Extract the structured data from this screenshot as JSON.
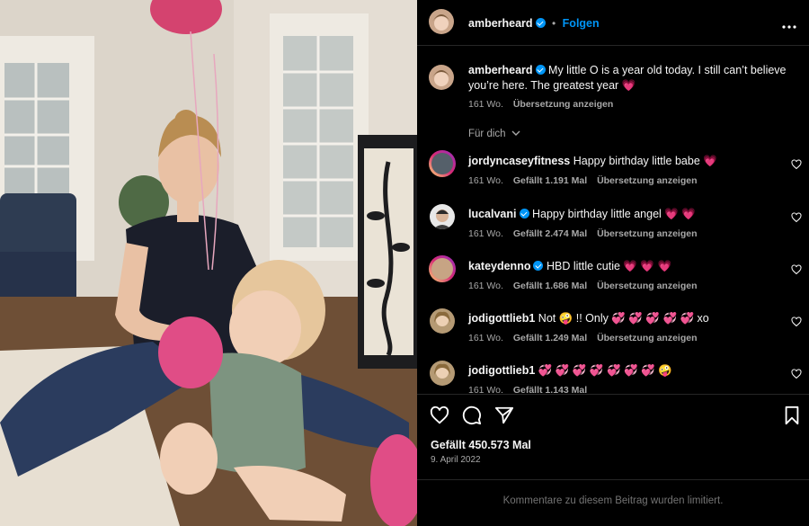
{
  "post": {
    "username": "amberheard",
    "follow_label": "Folgen",
    "caption": "My little O is a year old today. I still can’t believe you’re here. The greatest year",
    "caption_emoji": "💗",
    "caption_age": "161 Wo.",
    "caption_translate": "Übersetzung anzeigen",
    "filter_label": "Für dich",
    "likes": "Gefällt 450.573 Mal",
    "date": "9. April 2022",
    "comments_limited": "Kommentare zu diesem Beitrag wurden limitiert."
  },
  "comments": [
    {
      "username": "jordyncaseyfitness",
      "verified": false,
      "text": "Happy birthday little babe 💗",
      "age": "161 Wo.",
      "likes": "Gefällt 1.191 Mal",
      "translate": "Übersetzung anzeigen"
    },
    {
      "username": "lucalvani",
      "verified": true,
      "text": "Happy birthday little angel 💗 💗",
      "age": "161 Wo.",
      "likes": "Gefällt 2.474 Mal",
      "translate": "Übersetzung anzeigen"
    },
    {
      "username": "kateydenno",
      "verified": true,
      "text": "HBD little cutie 💗 💗 💗",
      "age": "161 Wo.",
      "likes": "Gefällt 1.686 Mal",
      "translate": "Übersetzung anzeigen"
    },
    {
      "username": "jodigottlieb1",
      "verified": false,
      "text": "Not 🤪 !! Only 💞 💞 💞 💞 💞 xo",
      "age": "161 Wo.",
      "likes": "Gefällt 1.249 Mal",
      "translate": "Übersetzung anzeigen"
    },
    {
      "username": "jodigottlieb1",
      "verified": false,
      "text": "💞 💞 💞 💞 💞 💞 💞 🤪",
      "age": "161 Wo.",
      "likes": "Gefällt 1.143 Mal",
      "translate": ""
    }
  ],
  "colors": {
    "background": "#000000",
    "text": "#f5f5f5",
    "muted": "#a8a8a8",
    "accent": "#0095f6",
    "divider": "#262626"
  }
}
